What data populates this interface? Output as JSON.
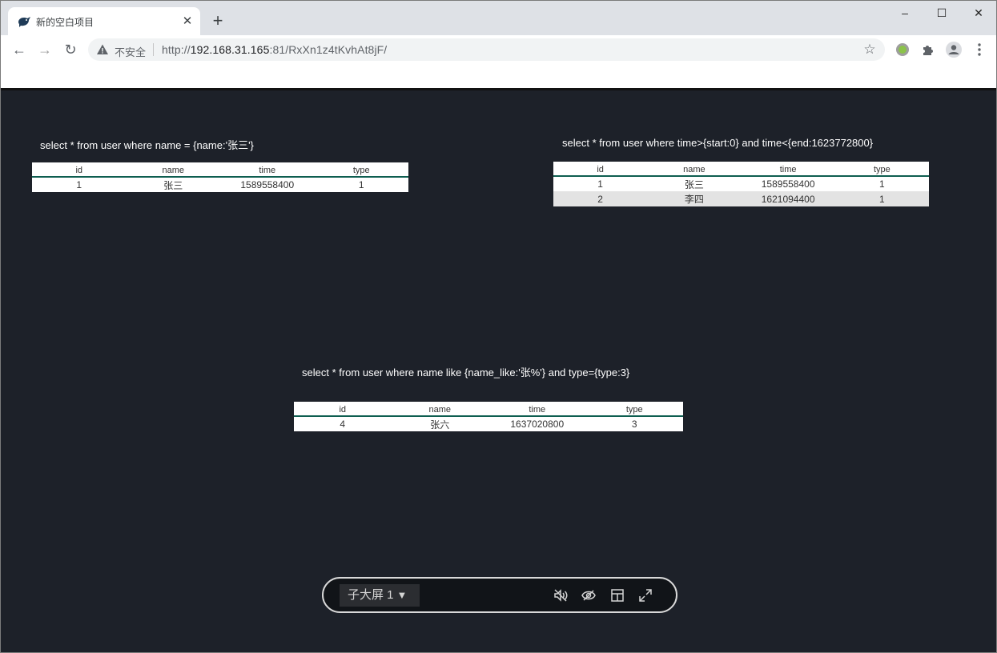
{
  "browser": {
    "tab_title": "新的空白项目",
    "tab_close": "✕",
    "new_tab": "+",
    "window_buttons": {
      "minimize": "–",
      "maximize": "☐",
      "close": "✕"
    },
    "nav": {
      "back": "←",
      "forward": "→",
      "reload": "↻"
    },
    "omnibox": {
      "security_text": "不安全",
      "url_scheme": "http://",
      "url_host": "192.168.31.165",
      "url_rest": ":81/RxXn1z4tKvhAt8jF/",
      "bookmark_star": "☆"
    }
  },
  "queries": [
    {
      "sql": "select * from user where name = {name:'张三'}",
      "columns": [
        "id",
        "name",
        "time",
        "type"
      ],
      "rows": [
        [
          "1",
          "张三",
          "1589558400",
          "1"
        ]
      ]
    },
    {
      "sql": "select * from user where time>{start:0} and time<{end:1623772800}",
      "columns": [
        "id",
        "name",
        "time",
        "type"
      ],
      "rows": [
        [
          "1",
          "张三",
          "1589558400",
          "1"
        ],
        [
          "2",
          "李四",
          "1621094400",
          "1"
        ]
      ]
    },
    {
      "sql": "select * from user where name like {name_like:'张%'} and type={type:3}",
      "columns": [
        "id",
        "name",
        "time",
        "type"
      ],
      "rows": [
        [
          "4",
          "张六",
          "1637020800",
          "3"
        ]
      ]
    }
  ],
  "control_bar": {
    "screen_select": "子大屏 1",
    "screen_select_arrow": "▼",
    "icons": [
      "mute-icon",
      "eye-icon",
      "layout-icon",
      "fullscreen-icon"
    ]
  },
  "colors": {
    "page_bg": "#1d2129",
    "table_header_rule": "#0e5e50",
    "alt_row": "#e3e3e3"
  }
}
